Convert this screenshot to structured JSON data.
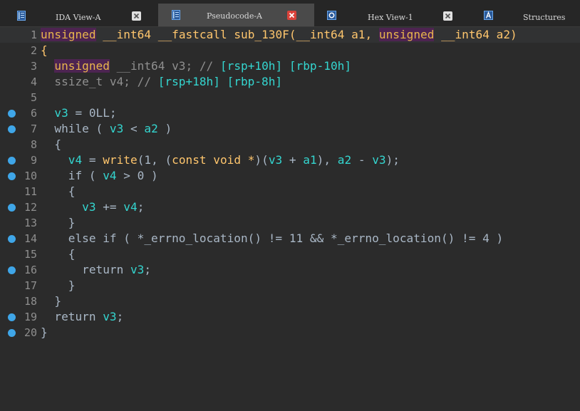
{
  "colors": {
    "background": "#2b2b2b",
    "tabbar": "#262626",
    "active_tab": "#4a4a4a",
    "breakpoint": "#3fa6e8",
    "close_red": "#d9423a",
    "close_grey": "#e0e0e0"
  },
  "tabs": [
    {
      "label": "IDA View-A",
      "icon": "ida-view-icon",
      "active": false,
      "close_style": "grey"
    },
    {
      "label": "Pseudocode-A",
      "icon": "pseudocode-icon",
      "active": true,
      "close_style": "red"
    },
    {
      "label": "Hex View-1",
      "icon": "hex-view-icon",
      "active": false,
      "close_style": "grey"
    },
    {
      "label": "Structures",
      "icon": "structures-icon",
      "active": false,
      "close_style": "none"
    }
  ],
  "code": {
    "lines": [
      {
        "n": "1",
        "bp": false,
        "tokens": [
          {
            "t": "unsigned",
            "c": "kwbg"
          },
          {
            "t": " ",
            "c": "id"
          },
          {
            "t": "__int64",
            "c": "kw"
          },
          {
            "t": " ",
            "c": "id"
          },
          {
            "t": "__fastcall",
            "c": "kw"
          },
          {
            "t": " ",
            "c": "id"
          },
          {
            "t": "sub_130F",
            "c": "kw"
          },
          {
            "t": "(",
            "c": "kw"
          },
          {
            "t": "__int64",
            "c": "kw"
          },
          {
            "t": " ",
            "c": "id"
          },
          {
            "t": "a1",
            "c": "kw"
          },
          {
            "t": ", ",
            "c": "kw"
          },
          {
            "t": "unsigned",
            "c": "kwbg"
          },
          {
            "t": " ",
            "c": "id"
          },
          {
            "t": "__int64",
            "c": "kw"
          },
          {
            "t": " ",
            "c": "id"
          },
          {
            "t": "a2",
            "c": "kw"
          },
          {
            "t": ")",
            "c": "kw"
          }
        ]
      },
      {
        "n": "2",
        "bp": false,
        "tokens": [
          {
            "t": "{",
            "c": "kw"
          }
        ]
      },
      {
        "n": "3",
        "bp": false,
        "tokens": [
          {
            "t": "  ",
            "c": "id"
          },
          {
            "t": "unsigned",
            "c": "kwbg"
          },
          {
            "t": " __int64 v3; // ",
            "c": "cm"
          },
          {
            "t": "[rsp+10h] [rbp-10h]",
            "c": "cmv"
          }
        ]
      },
      {
        "n": "4",
        "bp": false,
        "tokens": [
          {
            "t": "  ssize_t v4; // ",
            "c": "cm"
          },
          {
            "t": "[rsp+18h] [rbp-8h]",
            "c": "cmv"
          }
        ]
      },
      {
        "n": "5",
        "bp": false,
        "tokens": []
      },
      {
        "n": "6",
        "bp": true,
        "tokens": [
          {
            "t": "  ",
            "c": "id"
          },
          {
            "t": "v3",
            "c": "var"
          },
          {
            "t": " = 0LL;",
            "c": "id"
          }
        ]
      },
      {
        "n": "7",
        "bp": true,
        "tokens": [
          {
            "t": "  while ( ",
            "c": "id"
          },
          {
            "t": "v3",
            "c": "var"
          },
          {
            "t": " < ",
            "c": "id"
          },
          {
            "t": "a2",
            "c": "var"
          },
          {
            "t": " )",
            "c": "id"
          }
        ]
      },
      {
        "n": "8",
        "bp": false,
        "tokens": [
          {
            "t": "  {",
            "c": "id"
          }
        ]
      },
      {
        "n": "9",
        "bp": true,
        "tokens": [
          {
            "t": "    ",
            "c": "id"
          },
          {
            "t": "v4",
            "c": "var"
          },
          {
            "t": " = ",
            "c": "id"
          },
          {
            "t": "write",
            "c": "fn"
          },
          {
            "t": "(1, (",
            "c": "id"
          },
          {
            "t": "const void *",
            "c": "kw"
          },
          {
            "t": ")(",
            "c": "id"
          },
          {
            "t": "v3",
            "c": "var"
          },
          {
            "t": " + ",
            "c": "id"
          },
          {
            "t": "a1",
            "c": "var"
          },
          {
            "t": "), ",
            "c": "id"
          },
          {
            "t": "a2",
            "c": "var"
          },
          {
            "t": " - ",
            "c": "id"
          },
          {
            "t": "v3",
            "c": "var"
          },
          {
            "t": ");",
            "c": "id"
          }
        ]
      },
      {
        "n": "10",
        "bp": true,
        "tokens": [
          {
            "t": "    if ( ",
            "c": "id"
          },
          {
            "t": "v4",
            "c": "var"
          },
          {
            "t": " > 0 )",
            "c": "id"
          }
        ]
      },
      {
        "n": "11",
        "bp": false,
        "tokens": [
          {
            "t": "    {",
            "c": "id"
          }
        ]
      },
      {
        "n": "12",
        "bp": true,
        "tokens": [
          {
            "t": "      ",
            "c": "id"
          },
          {
            "t": "v3",
            "c": "var"
          },
          {
            "t": " += ",
            "c": "id"
          },
          {
            "t": "v4",
            "c": "var"
          },
          {
            "t": ";",
            "c": "id"
          }
        ]
      },
      {
        "n": "13",
        "bp": false,
        "tokens": [
          {
            "t": "    }",
            "c": "id"
          }
        ]
      },
      {
        "n": "14",
        "bp": true,
        "tokens": [
          {
            "t": "    else if ( *_errno_location() != 11 && *_errno_location() != 4 )",
            "c": "id"
          }
        ]
      },
      {
        "n": "15",
        "bp": false,
        "tokens": [
          {
            "t": "    {",
            "c": "id"
          }
        ]
      },
      {
        "n": "16",
        "bp": true,
        "tokens": [
          {
            "t": "      return ",
            "c": "id"
          },
          {
            "t": "v3",
            "c": "var"
          },
          {
            "t": ";",
            "c": "id"
          }
        ]
      },
      {
        "n": "17",
        "bp": false,
        "tokens": [
          {
            "t": "    }",
            "c": "id"
          }
        ]
      },
      {
        "n": "18",
        "bp": false,
        "tokens": [
          {
            "t": "  }",
            "c": "id"
          }
        ]
      },
      {
        "n": "19",
        "bp": true,
        "tokens": [
          {
            "t": "  return ",
            "c": "id"
          },
          {
            "t": "v3",
            "c": "var"
          },
          {
            "t": ";",
            "c": "id"
          }
        ]
      },
      {
        "n": "20",
        "bp": true,
        "tokens": [
          {
            "t": "}",
            "c": "id"
          }
        ]
      }
    ]
  }
}
